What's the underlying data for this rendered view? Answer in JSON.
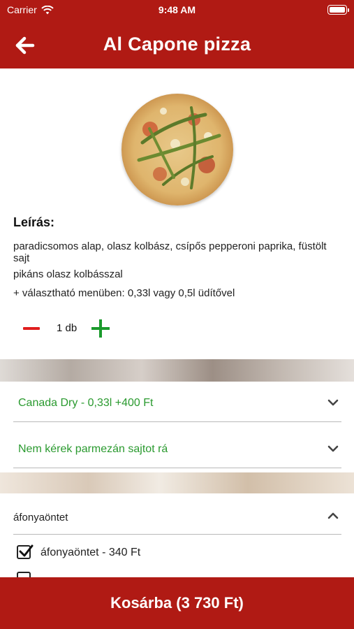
{
  "status_bar": {
    "carrier": "Carrier",
    "time": "9:48 AM"
  },
  "nav": {
    "title": "Al Capone pizza"
  },
  "description": {
    "heading": "Leírás:",
    "line1": "paradicsomos alap, olasz kolbász, csípős pepperoni paprika, füstölt sajt",
    "line2": "pikáns olasz kolbásszal",
    "line3": "+ választható menüben: 0,33l vagy 0,5l üdítővel"
  },
  "quantity": {
    "label": "1 db"
  },
  "options": [
    {
      "label": "Canada Dry - 0,33l +400 Ft"
    },
    {
      "label": "Nem kérek parmezán sajtot rá"
    }
  ],
  "extras": {
    "group_label": "áfonyaöntet",
    "items": [
      {
        "label": "áfonyaöntet - 340 Ft",
        "checked": true
      }
    ]
  },
  "cart_button": {
    "label": "Kosárba (3 730 Ft)"
  },
  "colors": {
    "brand_red": "#b01a14",
    "option_green": "#2a9a2f",
    "minus_red": "#e01e1e",
    "plus_green": "#1b9a2c"
  },
  "icons": [
    "wifi-icon",
    "battery-icon",
    "back-arrow-icon",
    "minus-icon",
    "plus-icon",
    "chevron-down-icon",
    "chevron-up-icon",
    "checkbox-checked-icon"
  ]
}
